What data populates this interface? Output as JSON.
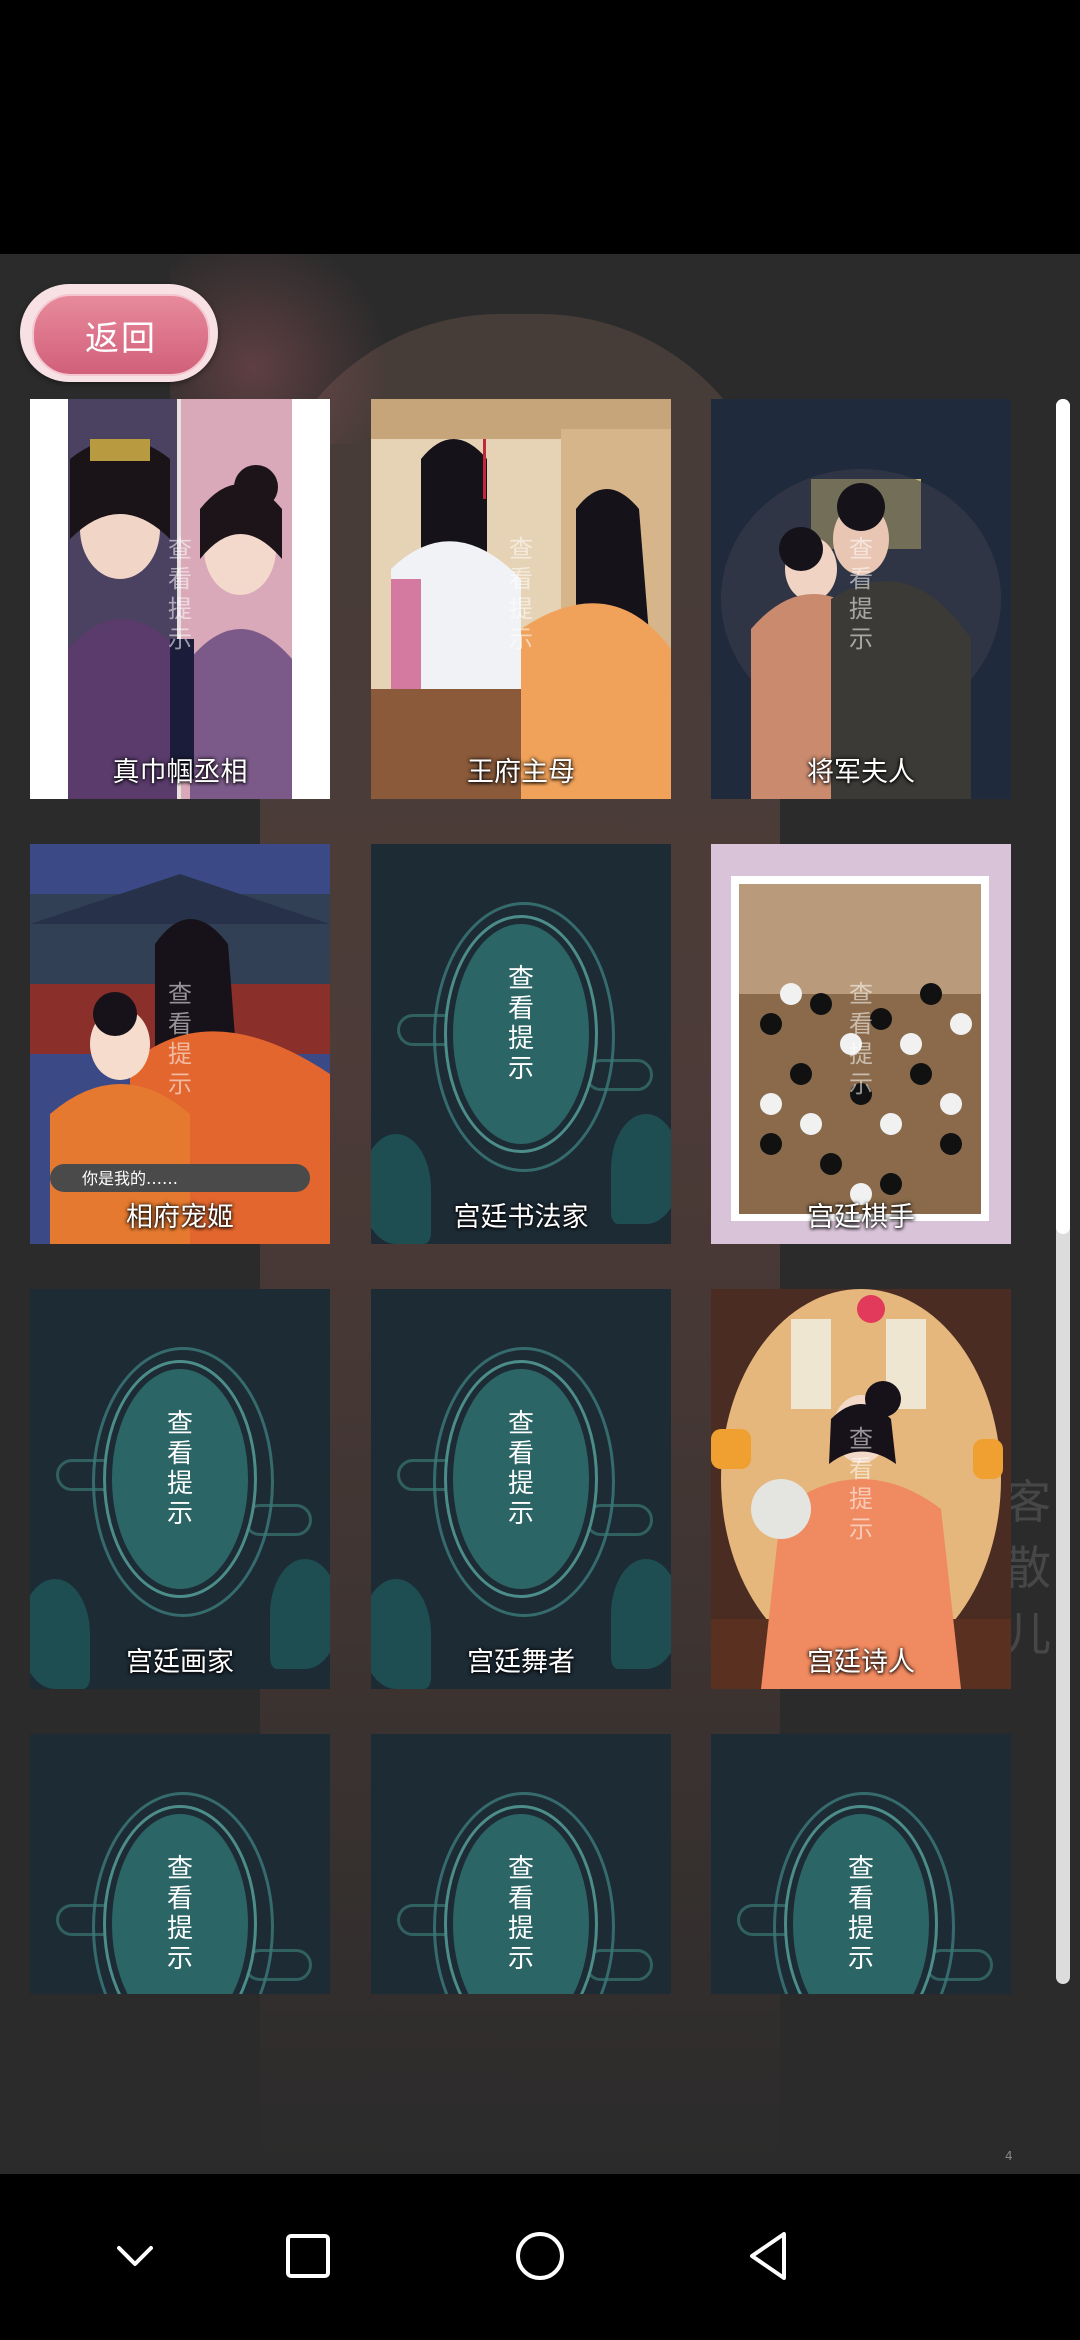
{
  "back_label": "返回",
  "hint_chars": [
    "查",
    "看",
    "提",
    "示"
  ],
  "cards": [
    {
      "title": "真巾帼丞相",
      "locked": false,
      "art": "portrait"
    },
    {
      "title": "王府主母",
      "locked": false,
      "art": "court"
    },
    {
      "title": "将军夫人",
      "locked": false,
      "art": "dark"
    },
    {
      "title": "相府宠姬",
      "locked": false,
      "art": "palace",
      "caption": "你是我的……"
    },
    {
      "title": "宫廷书法家",
      "locked": true
    },
    {
      "title": "宫廷棋手",
      "locked": false,
      "art": "go"
    },
    {
      "title": "宫廷画家",
      "locked": true
    },
    {
      "title": "宫廷舞者",
      "locked": true
    },
    {
      "title": "宫廷诗人",
      "locked": false,
      "art": "poet"
    },
    {
      "title": "",
      "locked": true
    },
    {
      "title": "",
      "locked": true
    },
    {
      "title": "",
      "locked": true
    }
  ],
  "overlay_text": "真巾帼丞",
  "side_poem": [
    "客",
    "散",
    "儿"
  ],
  "corner_number": "4",
  "nav": {
    "icons": [
      "chevron-down-icon",
      "recent-apps-icon",
      "home-icon",
      "back-icon"
    ]
  }
}
